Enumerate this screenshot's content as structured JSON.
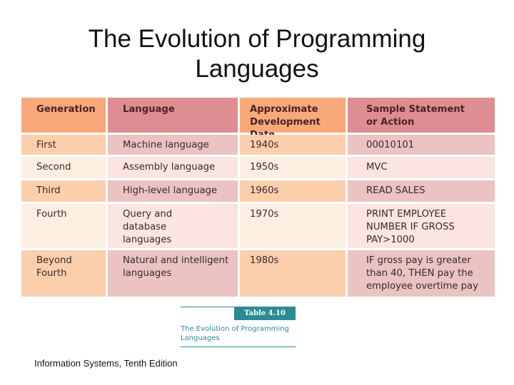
{
  "slide": {
    "title_line1": "The Evolution of Programming",
    "title_line2": "Languages",
    "footer": "Information Systems, Tenth Edition"
  },
  "table": {
    "headers": [
      "Generation",
      "Language",
      "Approximate Development Date",
      "Sample Statement or Action"
    ],
    "header_lines": [
      [
        "Generation"
      ],
      [
        "Language"
      ],
      [
        "Approximate",
        "Development Date"
      ],
      [
        "Sample Statement",
        "or Action"
      ]
    ],
    "rows": [
      {
        "generation": "First",
        "language": "Machine language",
        "date": "1940s",
        "sample": "00010101"
      },
      {
        "generation": "Second",
        "language": "Assembly language",
        "date": "1950s",
        "sample": "MVC"
      },
      {
        "generation": "Third",
        "language": "High-level language",
        "date": "1960s",
        "sample": "READ SALES"
      },
      {
        "generation": "Fourth",
        "language": "Query and database languages",
        "date": "1970s",
        "sample": "PRINT EMPLOYEE NUMBER IF GROSS PAY>1000"
      },
      {
        "generation": "Beyond Fourth",
        "language": "Natural and intelligent languages",
        "date": "1980s",
        "sample": "IF gross pay is greater than 40, THEN pay the employee overtime pay"
      }
    ],
    "colors": {
      "orange_header": "#f7a97a",
      "pink_header": "#de8e93",
      "orange_dark": "#fbcfac",
      "pink_dark": "#ebc3c3",
      "orange_light": "#fdf0e3",
      "pink_light": "#fbe4e1"
    }
  },
  "caption": {
    "label": "Table 4.10",
    "title": "The Evolution of Programming Languages",
    "accent": "#2c8a95"
  }
}
